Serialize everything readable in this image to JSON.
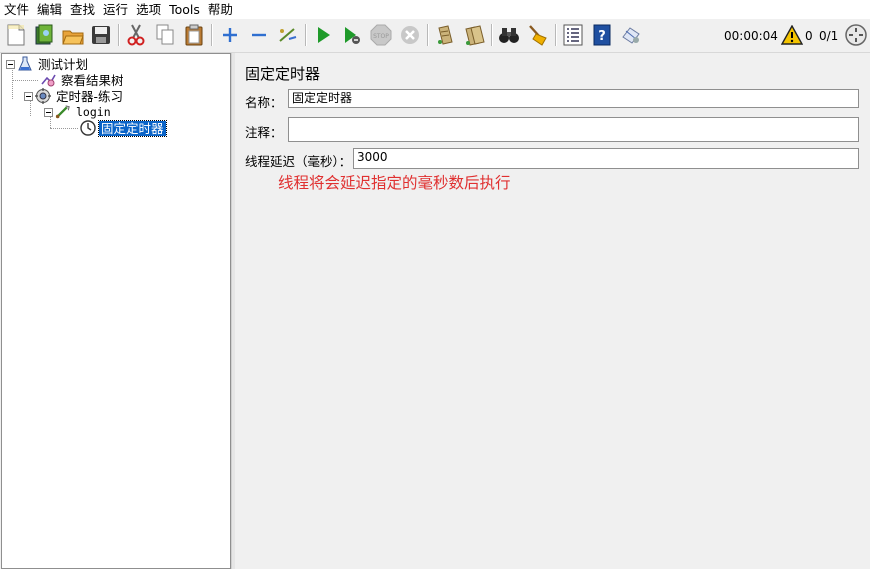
{
  "menu": [
    "文件",
    "编辑",
    "查找",
    "运行",
    "选项",
    "Tools",
    "帮助"
  ],
  "toolbar": {
    "icons": [
      "new-icon",
      "templates-icon",
      "open-icon",
      "save-icon",
      "cut-icon",
      "copy-icon",
      "paste-icon",
      "expand-icon",
      "collapse-icon",
      "toggle-icon",
      "start-icon",
      "start-no-pause-icon",
      "stop-icon",
      "shutdown-icon",
      "clear-icon",
      "clear-all-icon",
      "search-icon",
      "reset-search-icon",
      "function-helper-icon",
      "help-icon",
      "remote-icon"
    ],
    "timer": "00:00:04",
    "warning_count": "0",
    "threads": "0/1"
  },
  "tree": {
    "nodes": [
      {
        "label": "测试计划",
        "icon": "test-plan-icon"
      },
      {
        "label": "察看结果树",
        "icon": "listener-icon"
      },
      {
        "label": "定时器-练习",
        "icon": "thread-group-icon"
      },
      {
        "label": "login",
        "icon": "sampler-icon"
      },
      {
        "label": "固定定时器",
        "icon": "timer-icon",
        "selected": true
      }
    ]
  },
  "panel": {
    "title": "固定定时器",
    "name_label": "名称：",
    "name_value": "固定定时器",
    "comment_label": "注释：",
    "comment_value": "",
    "delay_label": "线程延迟（毫秒）：",
    "delay_value": "3000",
    "hint": "线程将会延迟指定的毫秒数后执行"
  },
  "colors": {
    "selection": "#0a64c8",
    "hint": "#e03030"
  }
}
